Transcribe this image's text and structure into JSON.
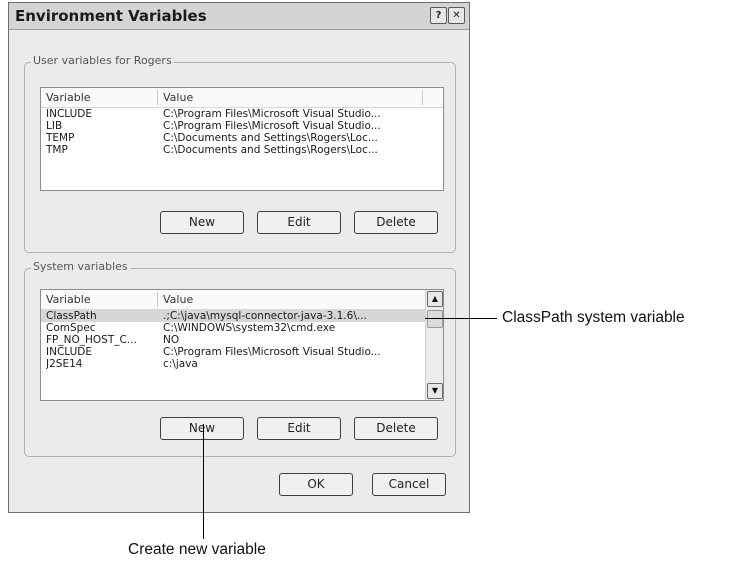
{
  "dialog": {
    "title": "Environment Variables",
    "help_label": "?",
    "close_label": "✕"
  },
  "user_vars": {
    "legend": "User variables for Rogers",
    "columns": [
      "Variable",
      "Value"
    ],
    "rows": [
      {
        "variable": "INCLUDE",
        "value": "C:\\Program Files\\Microsoft Visual Studio..."
      },
      {
        "variable": "LIB",
        "value": "C:\\Program Files\\Microsoft Visual Studio..."
      },
      {
        "variable": "TEMP",
        "value": "C:\\Documents and Settings\\Rogers\\Loc..."
      },
      {
        "variable": "TMP",
        "value": "C:\\Documents and Settings\\Rogers\\Loc..."
      }
    ],
    "new_label": "New",
    "edit_label": "Edit",
    "delete_label": "Delete"
  },
  "system_vars": {
    "legend": "System variables",
    "columns": [
      "Variable",
      "Value"
    ],
    "rows": [
      {
        "variable": "ClassPath",
        "value": ".;C:\\java\\mysql-connector-java-3.1.6\\..."
      },
      {
        "variable": "ComSpec",
        "value": "C:\\WINDOWS\\system32\\cmd.exe"
      },
      {
        "variable": "FP_NO_HOST_C...",
        "value": "NO"
      },
      {
        "variable": "INCLUDE",
        "value": "C:\\Program Files\\Microsoft Visual Studio..."
      },
      {
        "variable": "J2SE14",
        "value": "c:\\java"
      }
    ],
    "new_label": "New",
    "edit_label": "Edit",
    "delete_label": "Delete",
    "scroll_up_label": "▲",
    "scroll_down_label": "▼"
  },
  "footer": {
    "ok_label": "OK",
    "cancel_label": "Cancel"
  },
  "callouts": {
    "classpath": "ClassPath system variable",
    "new_variable": "Create new variable"
  }
}
